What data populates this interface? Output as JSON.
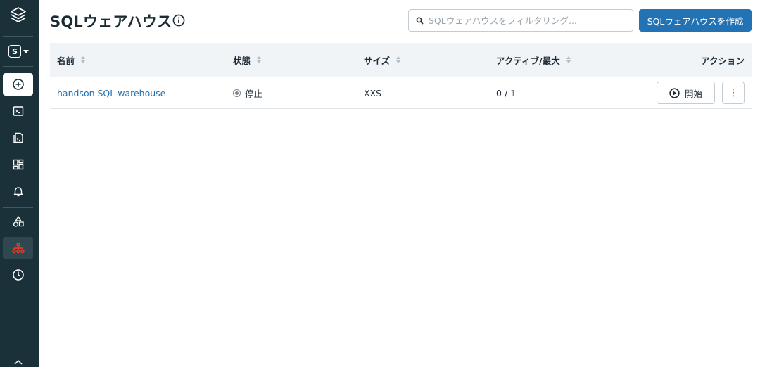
{
  "page": {
    "title": "SQLウェアハウス",
    "search_placeholder": "SQLウェアハウスをフィルタリング...",
    "create_button": "SQLウェアハウスを作成"
  },
  "sidebar": {
    "persona_letter": "S",
    "items": [
      {
        "name": "new",
        "icon": "plus-circle-icon"
      },
      {
        "name": "sql-editor",
        "icon": "terminal-icon"
      },
      {
        "name": "queries",
        "icon": "queries-icon"
      },
      {
        "name": "dashboards",
        "icon": "dashboard-icon"
      },
      {
        "name": "alerts",
        "icon": "bell-icon"
      },
      {
        "name": "data",
        "icon": "data-shapes-icon"
      },
      {
        "name": "sql-warehouses",
        "icon": "warehouse-icon",
        "active": true
      },
      {
        "name": "query-history",
        "icon": "clock-icon"
      }
    ],
    "accent_color": "#ff3621"
  },
  "table": {
    "columns": [
      "名前",
      "状態",
      "サイズ",
      "アクティブ/最大",
      "アクション"
    ],
    "rows": [
      {
        "name": "handson SQL warehouse",
        "status": "停止",
        "size": "XXS",
        "active": "0",
        "separator": "/",
        "max": "1",
        "start_label": "開始",
        "more_label": "⋮"
      }
    ]
  },
  "colors": {
    "sidebar_bg": "#1b3139",
    "primary": "#2272b4",
    "header_bg": "#f1f4f6"
  }
}
